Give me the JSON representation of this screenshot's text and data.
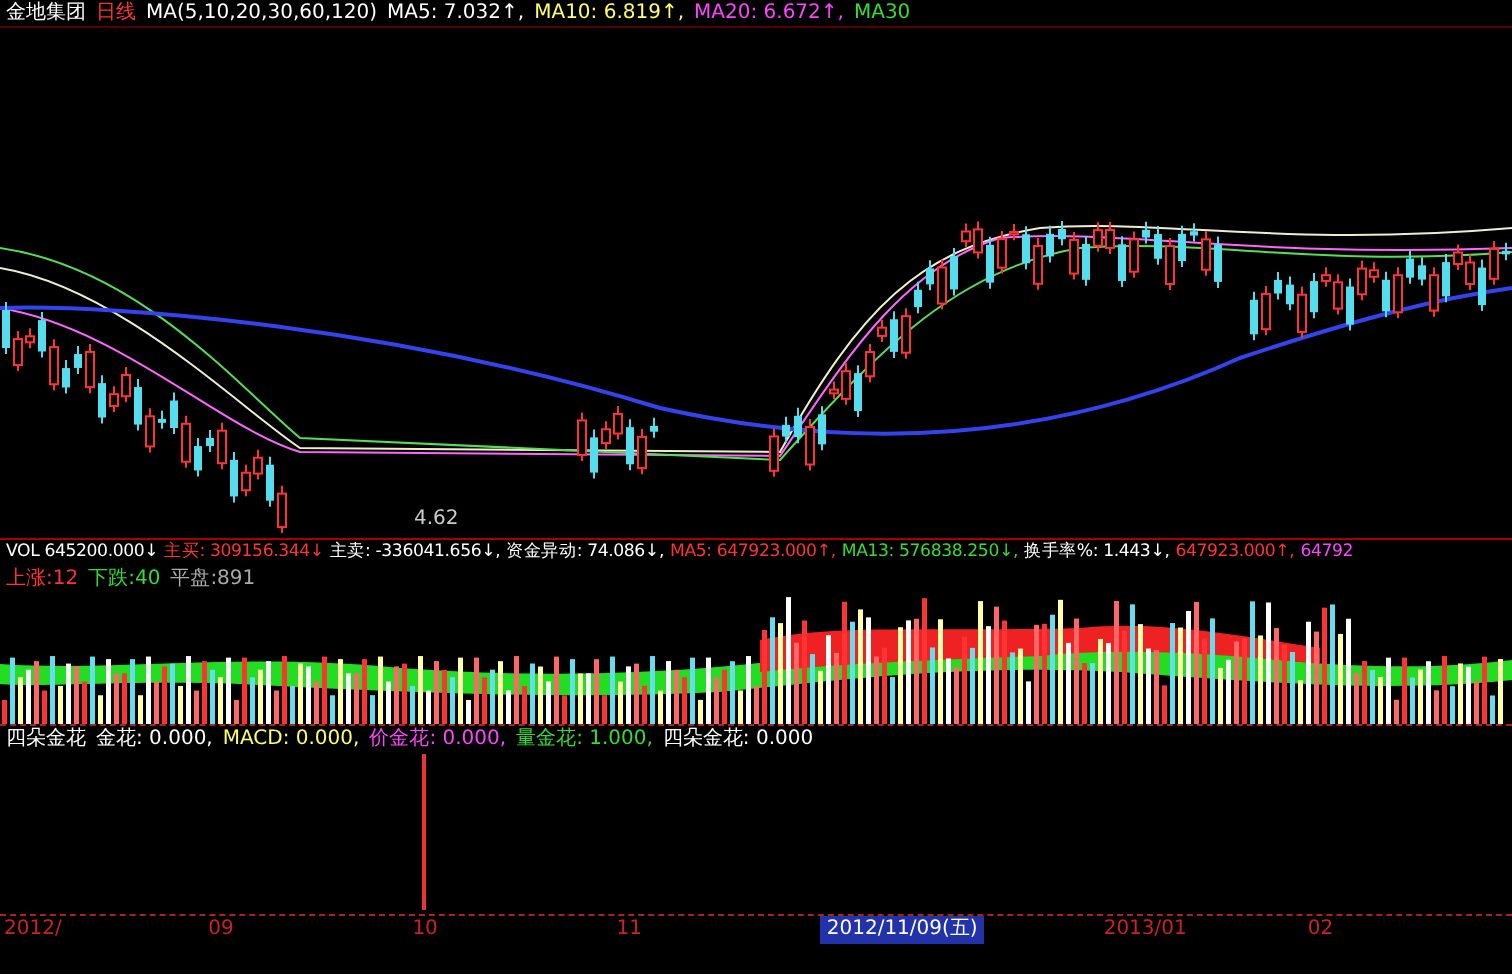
{
  "header": {
    "stock": "金地集团",
    "period": "日线",
    "ma_params": "MA(5,10,20,30,60,120)",
    "readings": [
      {
        "text": "MA5: 7.032↑,",
        "color": "#ffffff"
      },
      {
        "text": "MA10: 6.819↑,",
        "color": "#ffff66"
      },
      {
        "text": "MA20: 6.672↑,",
        "color": "#ff44ff"
      },
      {
        "text": "MA30",
        "color": "#33dd33"
      }
    ]
  },
  "price_label": "4.62",
  "volume_header": [
    {
      "text": "VOL 645200.000↓",
      "color": "#ffffff"
    },
    {
      "text": "主买: 309156.344↓",
      "color": "#ff3333"
    },
    {
      "text": "主卖: -336041.656↓,",
      "color": "#ffffff"
    },
    {
      "text": "资金异动: 74.086↓,",
      "color": "#ffffff"
    },
    {
      "text": "MA5: 647923.000↑,",
      "color": "#ff3333"
    },
    {
      "text": "MA13: 576838.250↓,",
      "color": "#33dd33"
    },
    {
      "text": "换手率%: 1.443↓,",
      "color": "#ffffff"
    },
    {
      "text": "647923.000↑,",
      "color": "#ff3333"
    },
    {
      "text": "64792",
      "color": "#ff44ff"
    }
  ],
  "breadth": [
    {
      "text": "上涨:12",
      "color": "#ff3333"
    },
    {
      "text": "下跌:40",
      "color": "#33dd33"
    },
    {
      "text": "平盘:891",
      "color": "#aaaaaa"
    }
  ],
  "indicator_header": [
    {
      "text": "四朵金花",
      "color": "#ffffff"
    },
    {
      "text": "金花: 0.000,",
      "color": "#ffffff"
    },
    {
      "text": "MACD: 0.000,",
      "color": "#ffff66"
    },
    {
      "text": "价金花: 0.000,",
      "color": "#ff44ff"
    },
    {
      "text": "量金花: 1.000,",
      "color": "#33dd33"
    },
    {
      "text": "四朵金花: 0.000",
      "color": "#ffffff"
    }
  ],
  "date_axis": [
    {
      "label": "2012/",
      "selected": false
    },
    {
      "label": "09",
      "selected": false
    },
    {
      "label": "10",
      "selected": false
    },
    {
      "label": "11",
      "selected": false
    },
    {
      "label": "2012/11/09(五)",
      "selected": true
    },
    {
      "label": "2013/01",
      "selected": false
    },
    {
      "label": "02",
      "selected": false
    }
  ]
}
